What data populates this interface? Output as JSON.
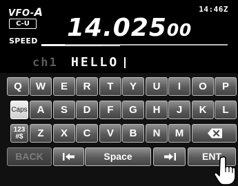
{
  "display": {
    "vfo_prefix": "VFO-",
    "vfo_letter": "A",
    "mode": "C-U",
    "speed_label": "SPEED",
    "speed_level": 0.77,
    "time": "14:46Z",
    "frequency_main": "14.025",
    "frequency_sub": "00"
  },
  "entry": {
    "channel": "ch1",
    "text": "HELLO"
  },
  "keyboard": {
    "row1": [
      "Q",
      "W",
      "E",
      "R",
      "T",
      "Y",
      "U",
      "I",
      "O",
      "P"
    ],
    "row2_caps": "Caps",
    "row2": [
      "A",
      "S",
      "D",
      "F",
      "G",
      "H",
      "J",
      "K",
      "L"
    ],
    "row3_sym_top": "123",
    "row3_sym_bottom": "#$",
    "row3": [
      "Z",
      "X",
      "C",
      "V",
      "B",
      "N",
      "M"
    ],
    "back": "BACK",
    "space": "Space",
    "ent": "ENT"
  },
  "icons": {
    "row3_last": "backspace-icon",
    "row4_left": "cursor-left-icon",
    "row4_right": "cursor-right-icon",
    "pointer": "hand-pointer-icon"
  }
}
